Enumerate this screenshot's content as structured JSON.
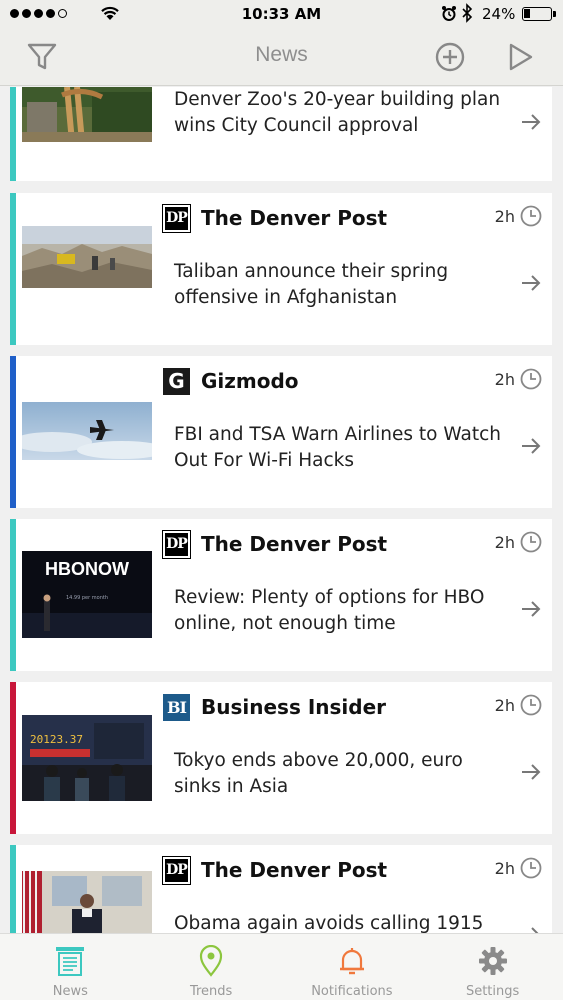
{
  "status": {
    "time": "10:33 AM",
    "battery": "24%"
  },
  "nav": {
    "title": "News"
  },
  "colors": {
    "teal": "#3cc8c0",
    "blue": "#1f5fc8",
    "red": "#c8163a",
    "accent_orange": "#f0783c",
    "accent_green": "#8cc63e"
  },
  "articles": [
    {
      "source": "",
      "logo": "",
      "age": "",
      "headline": "Denver Zoo's 20-year building plan wins City Council approval",
      "bar": "teal",
      "thumb": "giraffe"
    },
    {
      "source": "The Denver Post",
      "logo": "DP",
      "age": "2h",
      "headline": "Taliban announce their spring offensive in Afghanistan",
      "bar": "teal",
      "thumb": "rubble"
    },
    {
      "source": "Gizmodo",
      "logo": "G",
      "age": "2h",
      "headline": "FBI and TSA Warn Airlines to Watch Out For Wi-Fi Hacks",
      "bar": "blue",
      "thumb": "plane"
    },
    {
      "source": "The Denver Post",
      "logo": "DP",
      "age": "2h",
      "headline": "Review: Plenty of options for HBO online, not enough time",
      "bar": "teal",
      "thumb": "hbo"
    },
    {
      "source": "Business Insider",
      "logo": "BI",
      "age": "2h",
      "headline": "Tokyo ends above 20,000, euro sinks in Asia",
      "bar": "red",
      "thumb": "tokyo"
    },
    {
      "source": "The Denver Post",
      "logo": "DP",
      "age": "2h",
      "headline": "Obama again avoids calling 1915",
      "bar": "teal",
      "thumb": "obama"
    }
  ],
  "thumb_text": {
    "hbo_logo": "HBONOW",
    "hbo_sub": "14.99 per month",
    "tokyo_board": "20123.37"
  },
  "tabs": [
    {
      "label": "News",
      "icon": "newspaper-icon",
      "active": true
    },
    {
      "label": "Trends",
      "icon": "map-pin-icon",
      "active": false
    },
    {
      "label": "Notifications",
      "icon": "bell-icon",
      "active": false
    },
    {
      "label": "Settings",
      "icon": "gear-icon",
      "active": false
    }
  ]
}
